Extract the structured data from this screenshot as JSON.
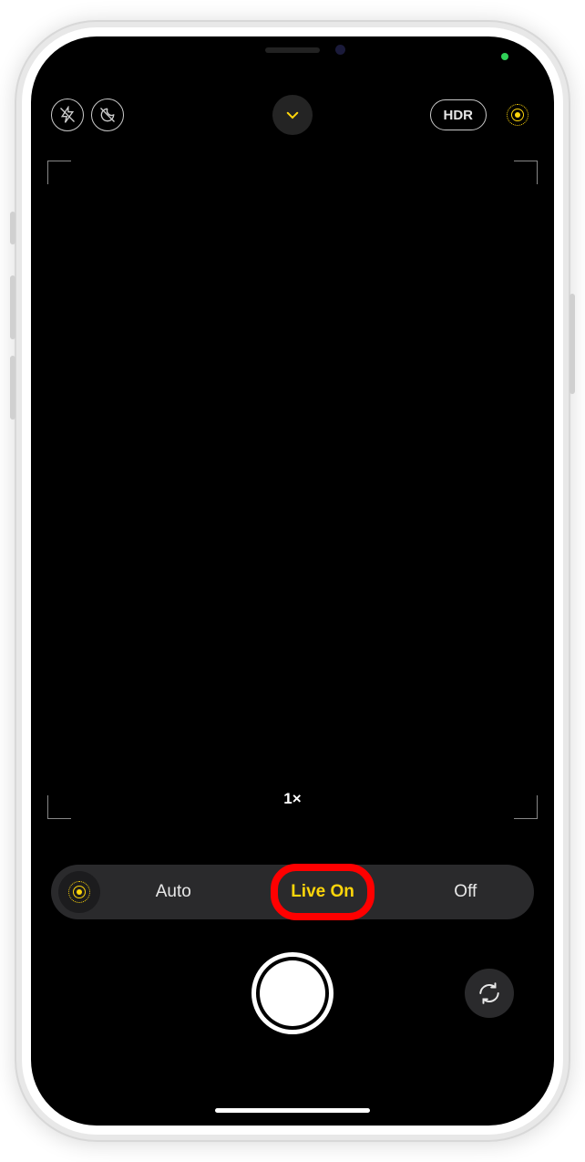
{
  "status": {
    "privacy_dot": "green"
  },
  "top_bar": {
    "flash_icon": "flash-off",
    "night_icon": "night-mode-off",
    "expand_icon": "chevron-down",
    "hdr_label": "HDR",
    "live_icon": "live-photo-on"
  },
  "viewfinder": {
    "zoom_label": "1×"
  },
  "live_options": {
    "icon": "live-photo",
    "items": [
      {
        "label": "Auto",
        "active": false
      },
      {
        "label": "Live On",
        "active": true
      },
      {
        "label": "Off",
        "active": false
      }
    ]
  },
  "controls": {
    "flip_icon": "camera-flip"
  },
  "annotation": {
    "highlighted_option_index": 1
  },
  "colors": {
    "accent": "#ffd60a",
    "annotation_ring": "#ff0000"
  }
}
